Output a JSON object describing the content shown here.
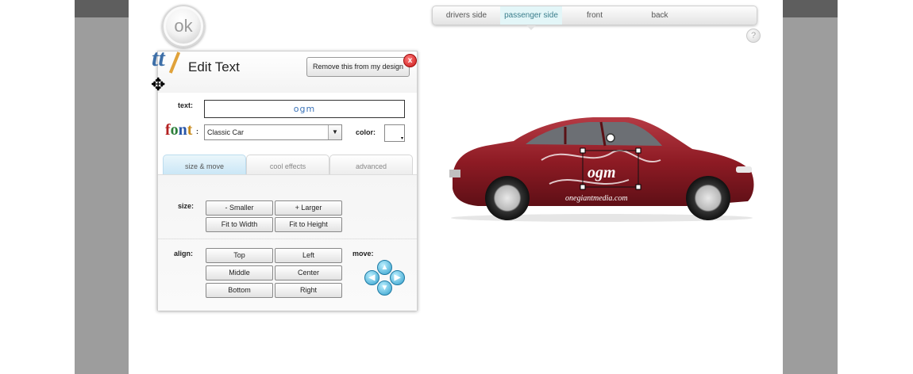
{
  "toolbar": {
    "ok_label": "ok",
    "help_label": "?"
  },
  "views": [
    {
      "label": "drivers side",
      "active": false
    },
    {
      "label": "passenger side",
      "active": true
    },
    {
      "label": "front",
      "active": false
    },
    {
      "label": "back",
      "active": false
    }
  ],
  "panel": {
    "title": "Edit Text",
    "remove_label": "Remove this from my design",
    "close_label": "x",
    "text_label": "text:",
    "text_value": "ogm",
    "font_label": ":",
    "font_value": "Classic Car",
    "color_label": "color:",
    "color_value": "#ffffff",
    "tabs": [
      {
        "label": "size & move",
        "active": true
      },
      {
        "label": "cool effects",
        "active": false
      },
      {
        "label": "advanced",
        "active": false
      }
    ],
    "size_label": "size:",
    "size_buttons": [
      "- Smaller",
      "+ Larger",
      "Fit to Width",
      "Fit to Height"
    ],
    "align_label": "align:",
    "align_buttons": [
      "Top",
      "Left",
      "Middle",
      "Center",
      "Bottom",
      "Right"
    ],
    "move_label": "move:"
  },
  "car": {
    "text": "ogm",
    "site_text": "onegiantmedia.com",
    "body_color": "#8e1b24"
  }
}
